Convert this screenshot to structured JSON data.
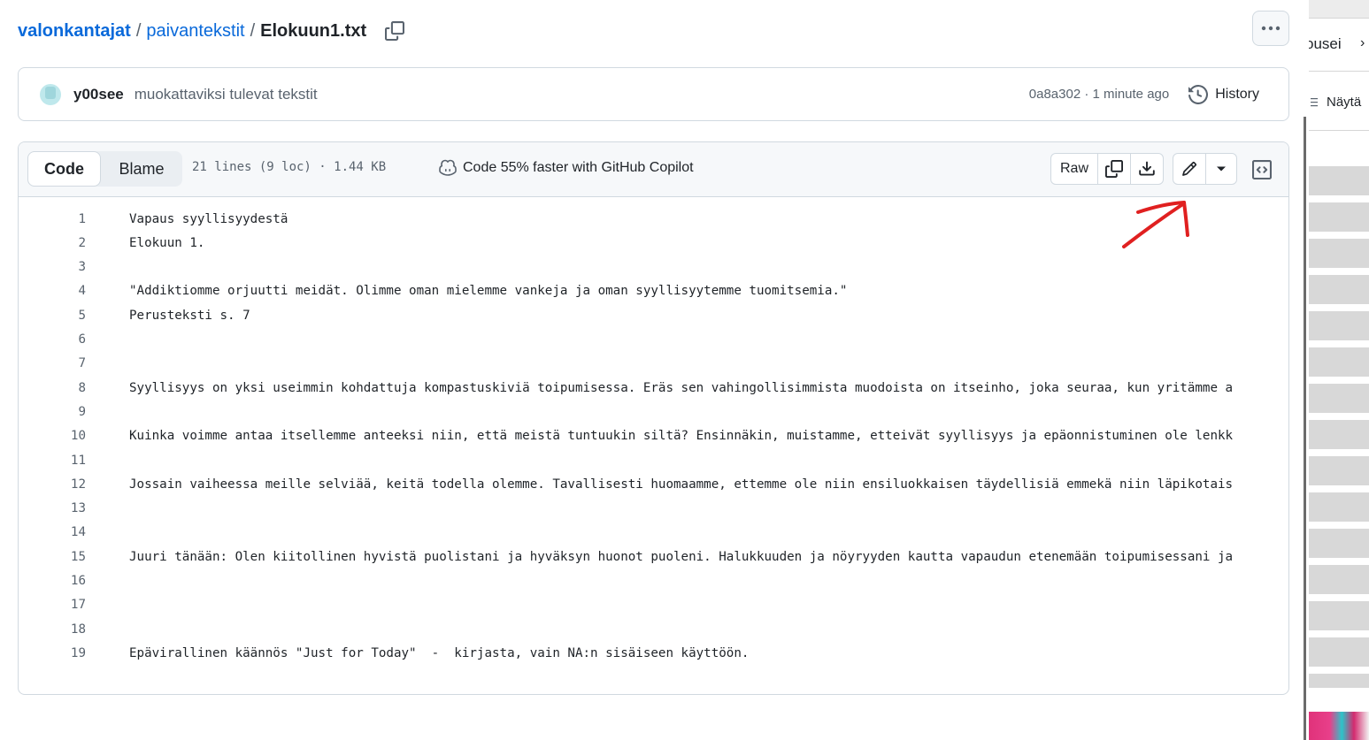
{
  "breadcrumb": {
    "owner": "valonkantajat",
    "separator": "/",
    "repo": "paivantekstit",
    "file": "Elokuun1.txt"
  },
  "commit": {
    "author": "y00see",
    "message": "muokattaviksi tulevat tekstit",
    "meta": "0a8a302 · 1 minute ago",
    "history_label": "History"
  },
  "file_header": {
    "code_tab": "Code",
    "blame_tab": "Blame",
    "info": "21 lines (9 loc) · 1.44 KB",
    "copilot": "Code 55% faster with GitHub Copilot",
    "raw_label": "Raw"
  },
  "lines": [
    {
      "n": "1",
      "text": "Vapaus syyllisyydestä"
    },
    {
      "n": "2",
      "text": "Elokuun 1."
    },
    {
      "n": "3",
      "text": ""
    },
    {
      "n": "4",
      "text": "\"Addiktiomme orjuutti meidät. Olimme oman mielemme vankeja ja oman syyllisyytemme tuomitsemia.\""
    },
    {
      "n": "5",
      "text": "Perusteksti s. 7"
    },
    {
      "n": "6",
      "text": ""
    },
    {
      "n": "7",
      "text": ""
    },
    {
      "n": "8",
      "text": "Syyllisyys on yksi useimmin kohdattuja kompastuskiviä toipumisessa. Eräs sen vahingollisimmista muodoista on itseinho, joka seuraa, kun yritämme a"
    },
    {
      "n": "9",
      "text": ""
    },
    {
      "n": "10",
      "text": "Kuinka voimme antaa itsellemme anteeksi niin, että meistä tuntuukin siltä? Ensinnäkin, muistamme, etteivät syyllisyys ja epäonnistuminen ole lenkk"
    },
    {
      "n": "11",
      "text": ""
    },
    {
      "n": "12",
      "text": "Jossain vaiheessa meille selviää, keitä todella olemme. Tavallisesti huomaamme, ettemme ole niin ensiluokkaisen täydellisiä emmekä niin läpikotais"
    },
    {
      "n": "13",
      "text": ""
    },
    {
      "n": "14",
      "text": ""
    },
    {
      "n": "15",
      "text": "Juuri tänään: Olen kiitollinen hyvistä puolistani ja hyväksyn huonot puoleni. Halukkuuden ja nöyryyden kautta vapaudun etenemään toipumisessani ja"
    },
    {
      "n": "16",
      "text": ""
    },
    {
      "n": "17",
      "text": ""
    },
    {
      "n": "18",
      "text": ""
    },
    {
      "n": "19",
      "text": "Epävirallinen käännös \"Just for Today\"  -  kirjasta, vain NA:n sisäiseen käyttöön."
    }
  ],
  "right_panel": {
    "item1": "ousei",
    "item2": "Näytä"
  },
  "colors": {
    "link": "#0969da",
    "muted": "#59636e",
    "border": "#d1d9e0",
    "annotation": "#e02020"
  }
}
